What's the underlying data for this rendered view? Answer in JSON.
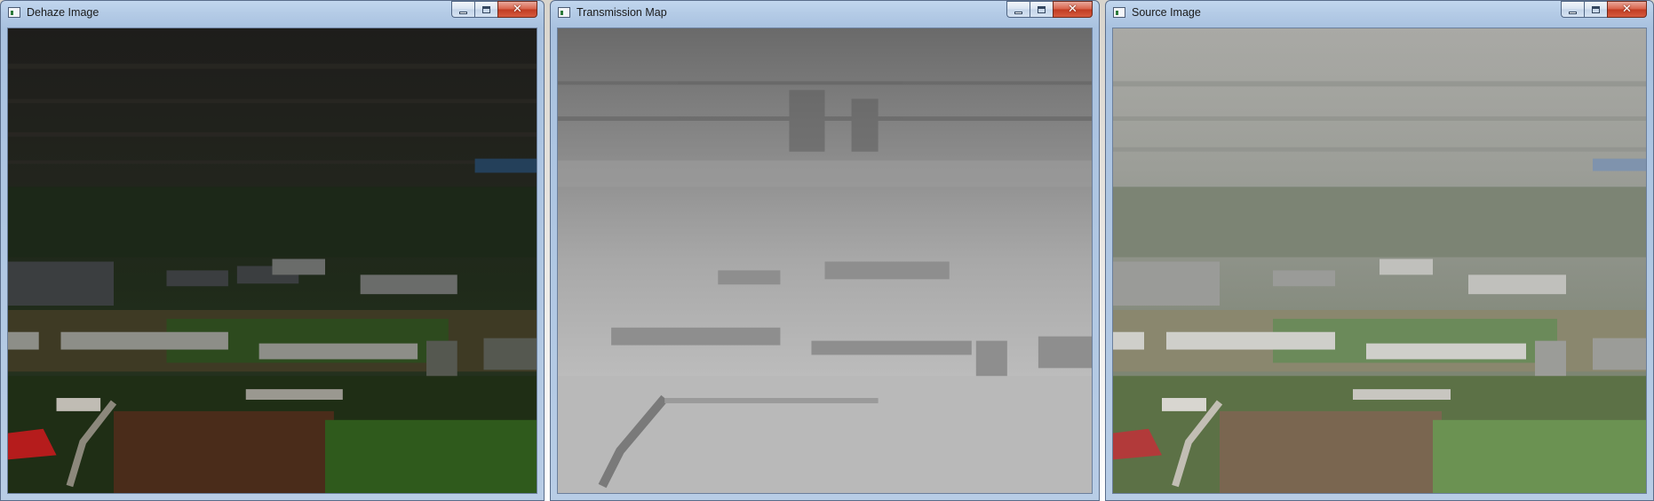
{
  "windows": [
    {
      "title": "Dehaze Image",
      "controls": {
        "minimize": "minimize-icon",
        "maximize": "maximize-icon",
        "close": "✕"
      }
    },
    {
      "title": "Transmission Map",
      "controls": {
        "minimize": "minimize-icon",
        "maximize": "maximize-icon",
        "close": "✕"
      }
    },
    {
      "title": "Source Image",
      "controls": {
        "minimize": "minimize-icon",
        "maximize": "maximize-icon",
        "close": "✕"
      }
    }
  ],
  "colors": {
    "titlebar": "#b4cbe6",
    "close_button": "#c13c22",
    "window_border": "#5a6d8a"
  }
}
